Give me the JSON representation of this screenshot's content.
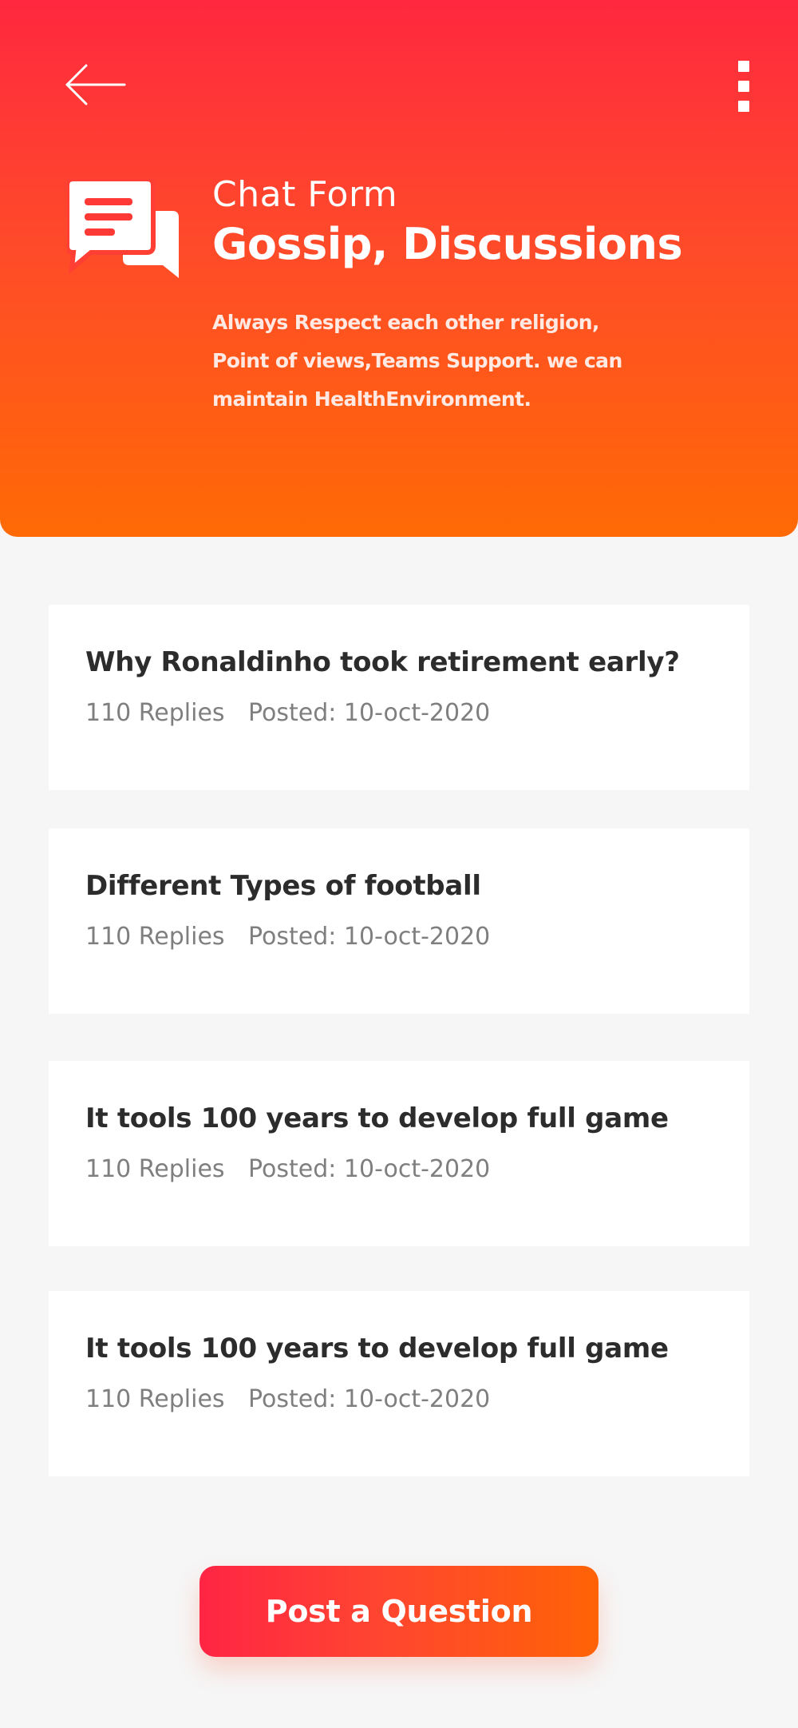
{
  "colors": {
    "header_gradient_top": "#ff283f",
    "header_gradient_bottom": "#ff6a05",
    "background": "#f6f6f6",
    "card_background": "#ffffff",
    "title_text": "#2c2c2c",
    "meta_text": "#7f7f7f"
  },
  "header": {
    "back_icon": "arrow-left-icon",
    "menu_icon": "more-vertical-icon",
    "chat_icon": "chat-bubbles-icon",
    "subtitle": "Chat Form",
    "title": "Gossip, Discussions",
    "description_lines": [
      "Always Respect each other religion,",
      "Point of views,Teams Support. we can",
      "maintain HealthEnvironment."
    ]
  },
  "topics": [
    {
      "title": "Why Ronaldinho took retirement early?",
      "replies": "110 Replies",
      "posted": "Posted: 10-oct-2020"
    },
    {
      "title": "Different Types of football",
      "replies": "110 Replies",
      "posted": "Posted: 10-oct-2020"
    },
    {
      "title": "It tools 100 years to develop full game",
      "replies": "110 Replies",
      "posted": "Posted: 10-oct-2020"
    },
    {
      "title": "It tools 100 years to develop full game",
      "replies": "110 Replies",
      "posted": "Posted: 10-oct-2020"
    }
  ],
  "post_button": {
    "label": "Post a Question"
  }
}
